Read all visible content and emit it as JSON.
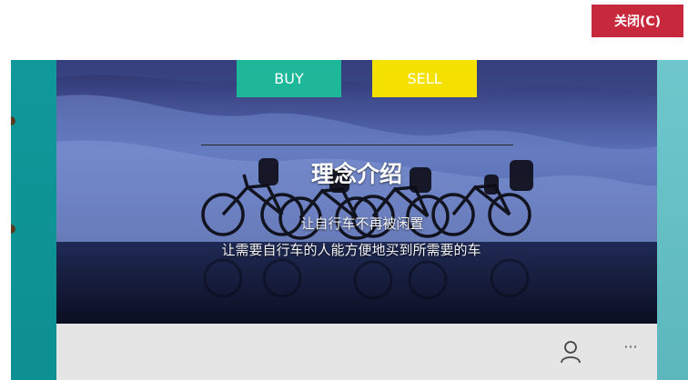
{
  "window": {
    "close_label": "关闭(C)"
  },
  "tabs": {
    "buy_label": "BUY",
    "sell_label": "SELL"
  },
  "hero": {
    "title": "理念介绍",
    "line1": "让自行车不再被闲置",
    "line2": "让需要自行车的人能方便地买到所需要的车"
  },
  "bottom_bar": {
    "user_icon": "person-icon",
    "more_icon": "ellipsis-icon",
    "more_glyph": "···"
  },
  "colors": {
    "close_bg": "#c8283c",
    "buy_bg": "#1fb79a",
    "sell_bg": "#f5e100",
    "left_strip": "#10989a",
    "right_strip": "#6ec7cc",
    "bottom_bar": "#e5e5e5"
  }
}
